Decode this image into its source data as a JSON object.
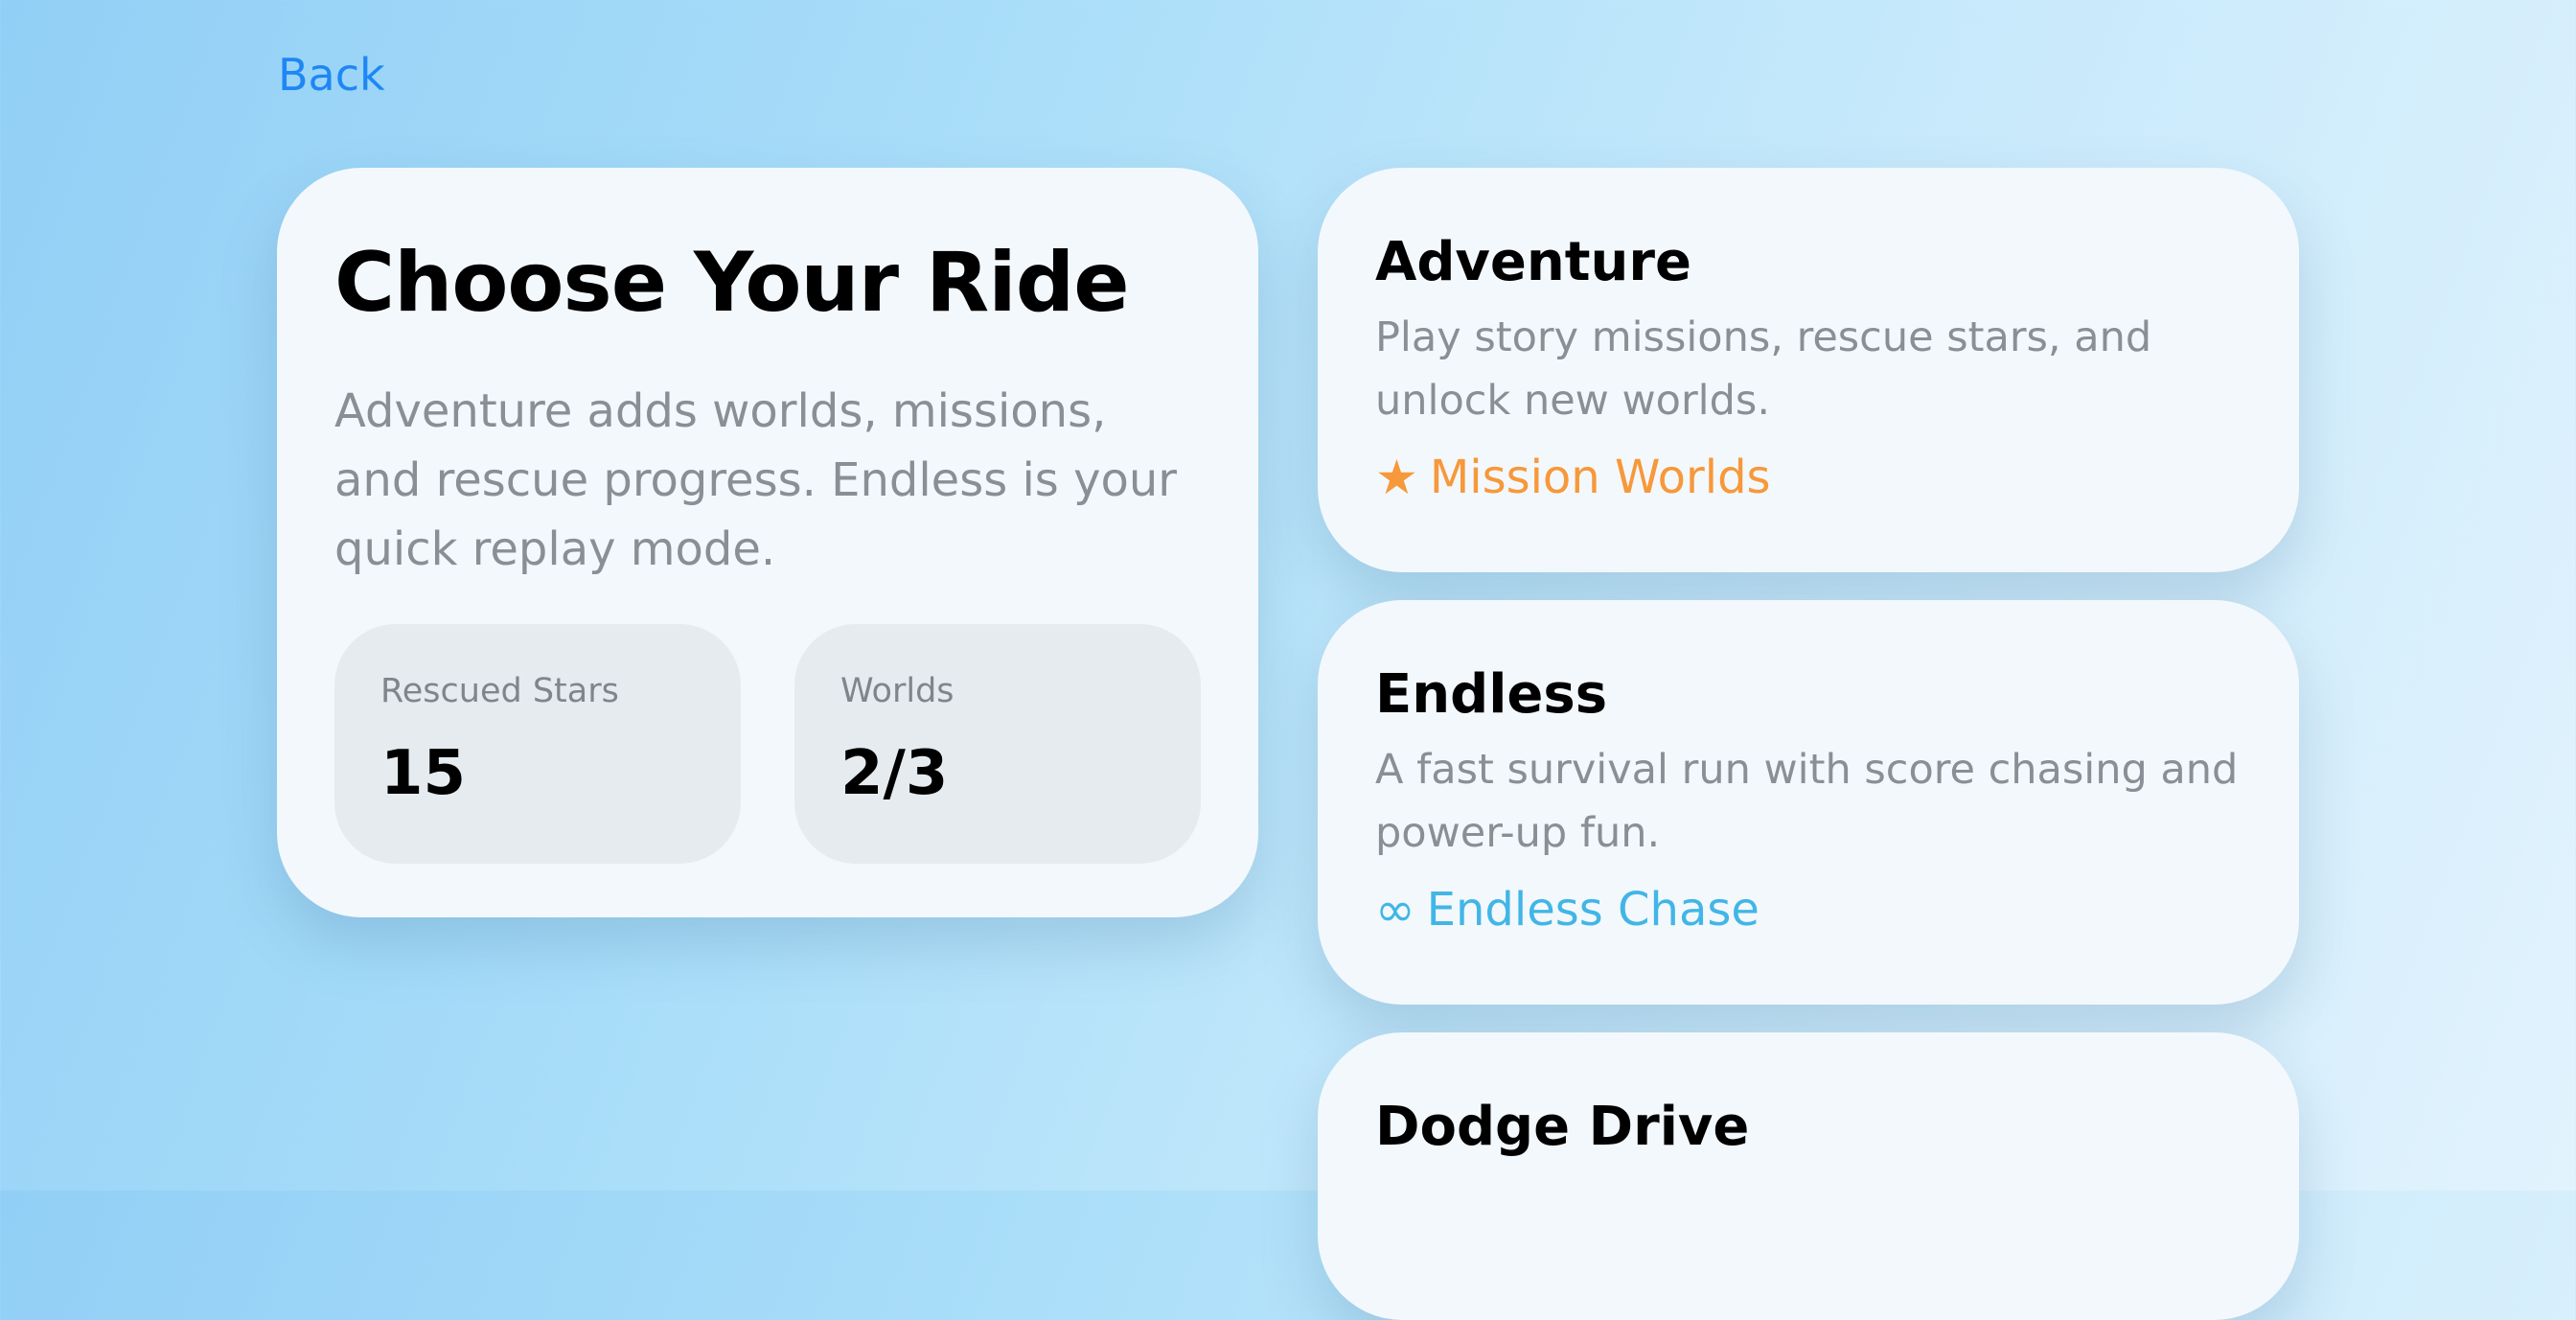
{
  "nav": {
    "back_label": "Back"
  },
  "intro": {
    "title": "Choose Your Ride",
    "body": "Adventure adds worlds, missions, and rescue progress. Endless is your quick replay mode.",
    "stats": [
      {
        "label": "Rescued Stars",
        "value": "15"
      },
      {
        "label": "Worlds",
        "value": "2/3"
      }
    ]
  },
  "modes": [
    {
      "title": "Adventure",
      "description": "Play story missions, rescue stars, and unlock new worlds.",
      "tag_icon": "star-icon",
      "tag_glyph": "★",
      "tag_label": "Mission Worlds",
      "tag_color": "#f7983a"
    },
    {
      "title": "Endless",
      "description": "A fast survival run with score chasing and power-up fun.",
      "tag_icon": "infinity-icon",
      "tag_glyph": "∞",
      "tag_label": "Endless Chase",
      "tag_color": "#41b6e6"
    },
    {
      "title": "Dodge Drive"
    }
  ],
  "colors": {
    "accent": "#1e87f5",
    "card_bg": "#f3f8fc",
    "stat_bg": "#e5ebef"
  }
}
